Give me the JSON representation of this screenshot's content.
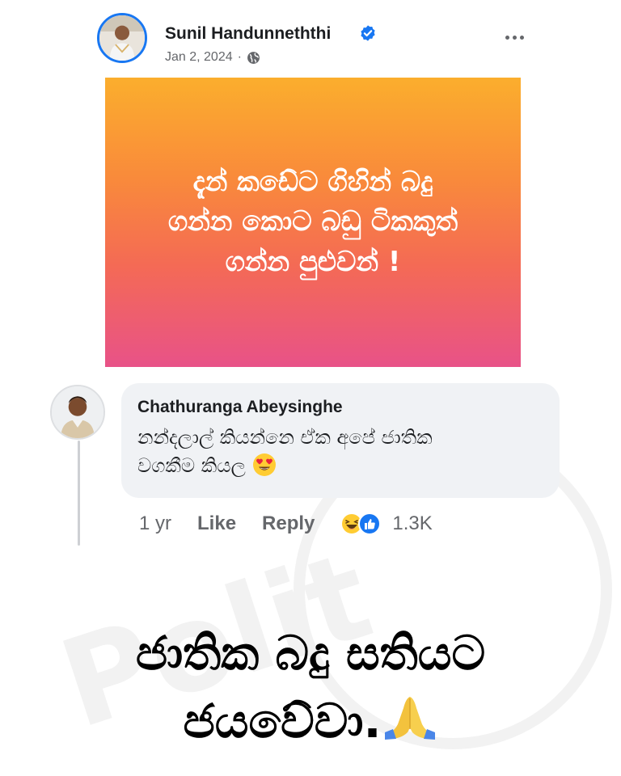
{
  "post": {
    "author": "Sunil Handunneththi",
    "date": "Jan 2, 2024",
    "separator": "·",
    "verified_icon": "verified-badge-icon",
    "privacy_icon": "globe-icon",
    "more_icon": "more-options-icon",
    "card_text": "දැන් කඩේට ගිහින් බදු\nගන්න කොට බඩු ටිකකුත්\nගන්න පුළුවන් !",
    "gradient_colors": [
      "#fbae2d",
      "#f98a3b",
      "#f46a55",
      "#e85288"
    ]
  },
  "comment": {
    "author": "Chathuranga Abeysinghe",
    "text": "නන්දලාල් කියන්නෙ ඒක අපේ ජාතික\nවගකීම කියල",
    "emoji": "heart-eyes-emoji",
    "time": "1 yr",
    "like_label": "Like",
    "reply_label": "Reply",
    "reaction_icons": [
      "laughing-reaction-icon",
      "like-reaction-icon"
    ],
    "reaction_count": "1.3K"
  },
  "caption": {
    "text": "ජාතික බදු සතියට\nජයවේවා.",
    "emoji": "praying-hands-emoji"
  },
  "colors": {
    "accent": "#1877f2",
    "bubble": "#f0f2f5",
    "muted_text": "#65676b"
  }
}
